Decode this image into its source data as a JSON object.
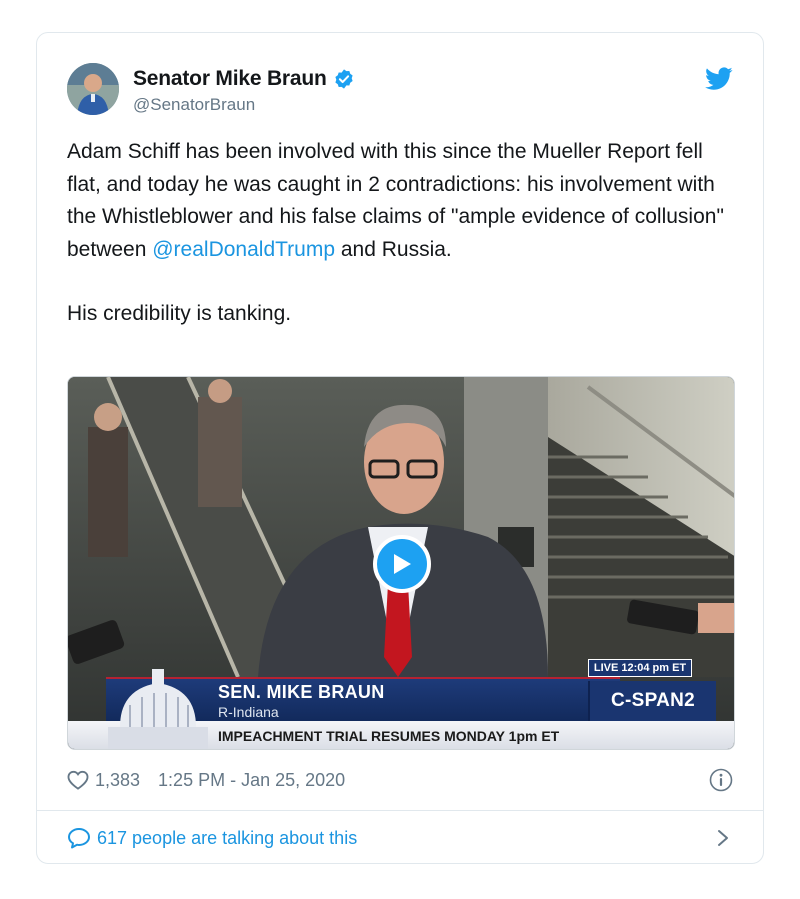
{
  "tweet": {
    "display_name": "Senator Mike Braun",
    "handle": "@SenatorBraun",
    "paragraph_1_before_mention": "Adam Schiff has been involved with this since the Mueller Report fell flat, and today he was caught in 2 contradictions: his involvement with the Whistleblower and his false claims of \"ample evidence of collusion\" between ",
    "mention": "@realDonaldTrump",
    "paragraph_1_after_mention": " and Russia.",
    "paragraph_2": "His credibility is tanking.",
    "likes": "1,383",
    "timestamp": "1:25 PM - Jan 25, 2020",
    "talking": "617 people are talking about this"
  },
  "video": {
    "live_label": "LIVE 12:04 pm ET",
    "name_line": "SEN. MIKE BRAUN",
    "state_line": "R-Indiana",
    "network": "C-SPAN2",
    "ticker": "IMPEACHMENT TRIAL RESUMES MONDAY 1pm ET"
  },
  "colors": {
    "link": "#1b95e0",
    "verified": "#1da1f2",
    "muted": "#657786",
    "border": "#e1e8ed"
  },
  "icons": [
    "verified-badge-icon",
    "twitter-bird-icon",
    "play-icon",
    "heart-icon",
    "info-icon",
    "speech-bubble-icon",
    "chevron-right-icon"
  ]
}
